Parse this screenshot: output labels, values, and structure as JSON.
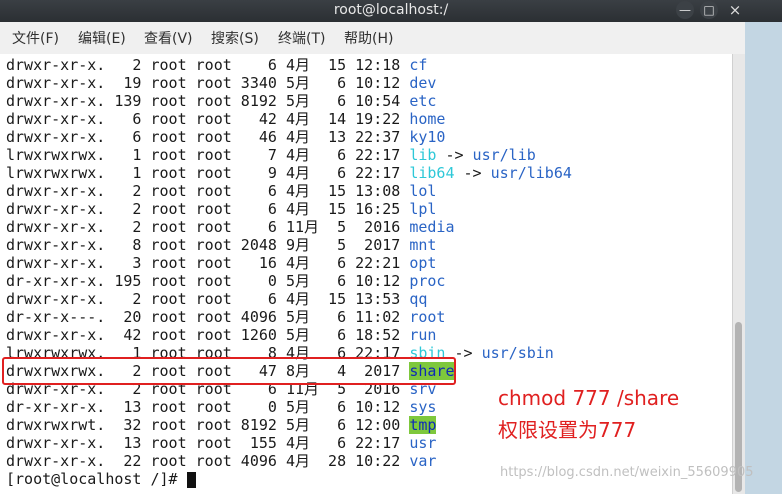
{
  "window": {
    "title": "root@localhost:/",
    "minimize_glyph": "—",
    "maximize_glyph": "□",
    "close_glyph": "×"
  },
  "menu": [
    {
      "label": "文件(F)"
    },
    {
      "label": "编辑(E)"
    },
    {
      "label": "查看(V)"
    },
    {
      "label": "搜索(S)"
    },
    {
      "label": "终端(T)"
    },
    {
      "label": "帮助(H)"
    }
  ],
  "listing": [
    {
      "perm": "drwxr-xr-x.",
      "links": "2",
      "owner": "root",
      "group": "root",
      "size": "6",
      "month": "4月",
      "day": "15",
      "time": "12:18",
      "name": "cf",
      "type": "dir"
    },
    {
      "perm": "drwxr-xr-x.",
      "links": "19",
      "owner": "root",
      "group": "root",
      "size": "3340",
      "month": "5月",
      "day": "6",
      "time": "10:12",
      "name": "dev",
      "type": "dir"
    },
    {
      "perm": "drwxr-xr-x.",
      "links": "139",
      "owner": "root",
      "group": "root",
      "size": "8192",
      "month": "5月",
      "day": "6",
      "time": "10:54",
      "name": "etc",
      "type": "dir"
    },
    {
      "perm": "drwxr-xr-x.",
      "links": "6",
      "owner": "root",
      "group": "root",
      "size": "42",
      "month": "4月",
      "day": "14",
      "time": "19:22",
      "name": "home",
      "type": "dir"
    },
    {
      "perm": "drwxr-xr-x.",
      "links": "6",
      "owner": "root",
      "group": "root",
      "size": "46",
      "month": "4月",
      "day": "13",
      "time": "22:37",
      "name": "ky10",
      "type": "dir"
    },
    {
      "perm": "lrwxrwxrwx.",
      "links": "1",
      "owner": "root",
      "group": "root",
      "size": "7",
      "month": "4月",
      "day": "6",
      "time": "22:17",
      "name": "lib",
      "type": "link",
      "arrow": "->",
      "target": "usr/lib"
    },
    {
      "perm": "lrwxrwxrwx.",
      "links": "1",
      "owner": "root",
      "group": "root",
      "size": "9",
      "month": "4月",
      "day": "6",
      "time": "22:17",
      "name": "lib64",
      "type": "link",
      "arrow": "->",
      "target": "usr/lib64"
    },
    {
      "perm": "drwxr-xr-x.",
      "links": "2",
      "owner": "root",
      "group": "root",
      "size": "6",
      "month": "4月",
      "day": "15",
      "time": "13:08",
      "name": "lol",
      "type": "dir"
    },
    {
      "perm": "drwxr-xr-x.",
      "links": "2",
      "owner": "root",
      "group": "root",
      "size": "6",
      "month": "4月",
      "day": "15",
      "time": "16:25",
      "name": "lpl",
      "type": "dir"
    },
    {
      "perm": "drwxr-xr-x.",
      "links": "2",
      "owner": "root",
      "group": "root",
      "size": "6",
      "month": "11月",
      "day": "5",
      "time": "2016",
      "name": "media",
      "type": "dir"
    },
    {
      "perm": "drwxr-xr-x.",
      "links": "8",
      "owner": "root",
      "group": "root",
      "size": "2048",
      "month": "9月",
      "day": "5",
      "time": "2017",
      "name": "mnt",
      "type": "dir"
    },
    {
      "perm": "drwxr-xr-x.",
      "links": "3",
      "owner": "root",
      "group": "root",
      "size": "16",
      "month": "4月",
      "day": "6",
      "time": "22:21",
      "name": "opt",
      "type": "dir"
    },
    {
      "perm": "dr-xr-xr-x.",
      "links": "195",
      "owner": "root",
      "group": "root",
      "size": "0",
      "month": "5月",
      "day": "6",
      "time": "10:12",
      "name": "proc",
      "type": "dir"
    },
    {
      "perm": "drwxr-xr-x.",
      "links": "2",
      "owner": "root",
      "group": "root",
      "size": "6",
      "month": "4月",
      "day": "15",
      "time": "13:53",
      "name": "qq",
      "type": "dir"
    },
    {
      "perm": "dr-xr-x---.",
      "links": "20",
      "owner": "root",
      "group": "root",
      "size": "4096",
      "month": "5月",
      "day": "6",
      "time": "11:02",
      "name": "root",
      "type": "dir"
    },
    {
      "perm": "drwxr-xr-x.",
      "links": "42",
      "owner": "root",
      "group": "root",
      "size": "1260",
      "month": "5月",
      "day": "6",
      "time": "18:52",
      "name": "run",
      "type": "dir"
    },
    {
      "perm": "lrwxrwxrwx.",
      "links": "1",
      "owner": "root",
      "group": "root",
      "size": "8",
      "month": "4月",
      "day": "6",
      "time": "22:17",
      "name": "sbin",
      "type": "link",
      "arrow": "->",
      "target": "usr/sbin"
    },
    {
      "perm": "drwxrwxrwx.",
      "links": "2",
      "owner": "root",
      "group": "root",
      "size": "47",
      "month": "8月",
      "day": "4",
      "time": "2017",
      "name": "share",
      "type": "hl"
    },
    {
      "perm": "drwxr-xr-x.",
      "links": "2",
      "owner": "root",
      "group": "root",
      "size": "6",
      "month": "11月",
      "day": "5",
      "time": "2016",
      "name": "srv",
      "type": "dir"
    },
    {
      "perm": "dr-xr-xr-x.",
      "links": "13",
      "owner": "root",
      "group": "root",
      "size": "0",
      "month": "5月",
      "day": "6",
      "time": "10:12",
      "name": "sys",
      "type": "dir"
    },
    {
      "perm": "drwxrwxrwt.",
      "links": "32",
      "owner": "root",
      "group": "root",
      "size": "8192",
      "month": "5月",
      "day": "6",
      "time": "12:00",
      "name": "tmp",
      "type": "hl"
    },
    {
      "perm": "drwxr-xr-x.",
      "links": "13",
      "owner": "root",
      "group": "root",
      "size": "155",
      "month": "4月",
      "day": "6",
      "time": "22:17",
      "name": "usr",
      "type": "dir"
    },
    {
      "perm": "drwxr-xr-x.",
      "links": "22",
      "owner": "root",
      "group": "root",
      "size": "4096",
      "month": "4月",
      "day": "28",
      "time": "10:22",
      "name": "var",
      "type": "dir"
    }
  ],
  "prompt": "[root@localhost /]#",
  "annotation": {
    "line1": "chmod 777 /share",
    "line2": "权限设置为777"
  },
  "watermark": "https://blog.csdn.net/weixin_55609905",
  "colors": {
    "dir": "#2a64c5",
    "link": "#2ec8d8",
    "highlight_bg": "#7ec83c",
    "annotation": "#e02020"
  }
}
